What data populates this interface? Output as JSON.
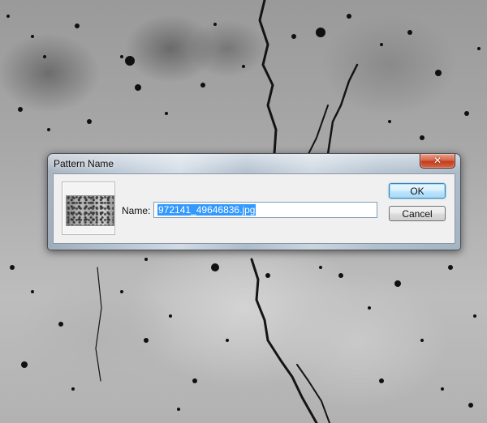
{
  "dialog": {
    "title": "Pattern Name",
    "close_icon": "close-icon",
    "name_label": "Name:",
    "name_value": "972141_49646836.jpg",
    "ok_label": "OK",
    "cancel_label": "Cancel",
    "selection_color": "#3399ff",
    "close_color": "#c23b1c"
  }
}
